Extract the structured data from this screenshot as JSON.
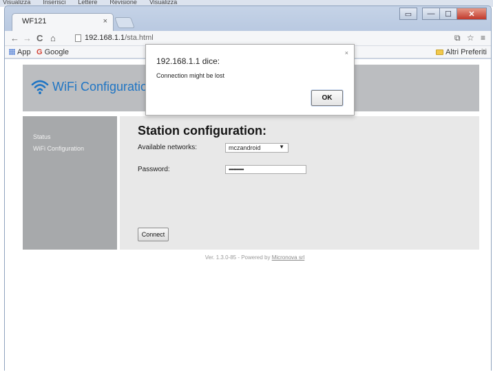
{
  "os_menu": [
    "Visualizza",
    "Inserisci",
    "Lettere",
    "Revisione",
    "Visualizza"
  ],
  "browser": {
    "tab_title": "WF121",
    "tab_close": "×",
    "url_host": "192.168.1.1",
    "url_path": "/sta.html",
    "bookmarks": {
      "apps": "App",
      "google": "Google",
      "others": "Altri Preferiti"
    },
    "window_controls": {
      "minimize": "—",
      "maximize": "☐",
      "close": "✕"
    }
  },
  "page": {
    "logo_text": "WiFi Configuration",
    "sidebar": [
      {
        "label": "Status"
      },
      {
        "label": "WiFi Configuration"
      }
    ],
    "title": "Station configuration:",
    "networks_label": "Available networks:",
    "networks_selected": "mczandroid",
    "password_label": "Password:",
    "password_value": "••••••••••••",
    "connect_label": "Connect",
    "footer_text": "Ver. 1.3.0-85 - Powered by ",
    "footer_link": "Micronova srl"
  },
  "dialog": {
    "title": "192.168.1.1 dice:",
    "message": "Connection might be lost",
    "ok_label": "OK",
    "close": "×"
  },
  "colors": {
    "accent": "#1f75c4",
    "header_bg": "#bbbdc0",
    "sidebar_bg": "#a7a9ab",
    "main_bg": "#e8e8e8"
  }
}
